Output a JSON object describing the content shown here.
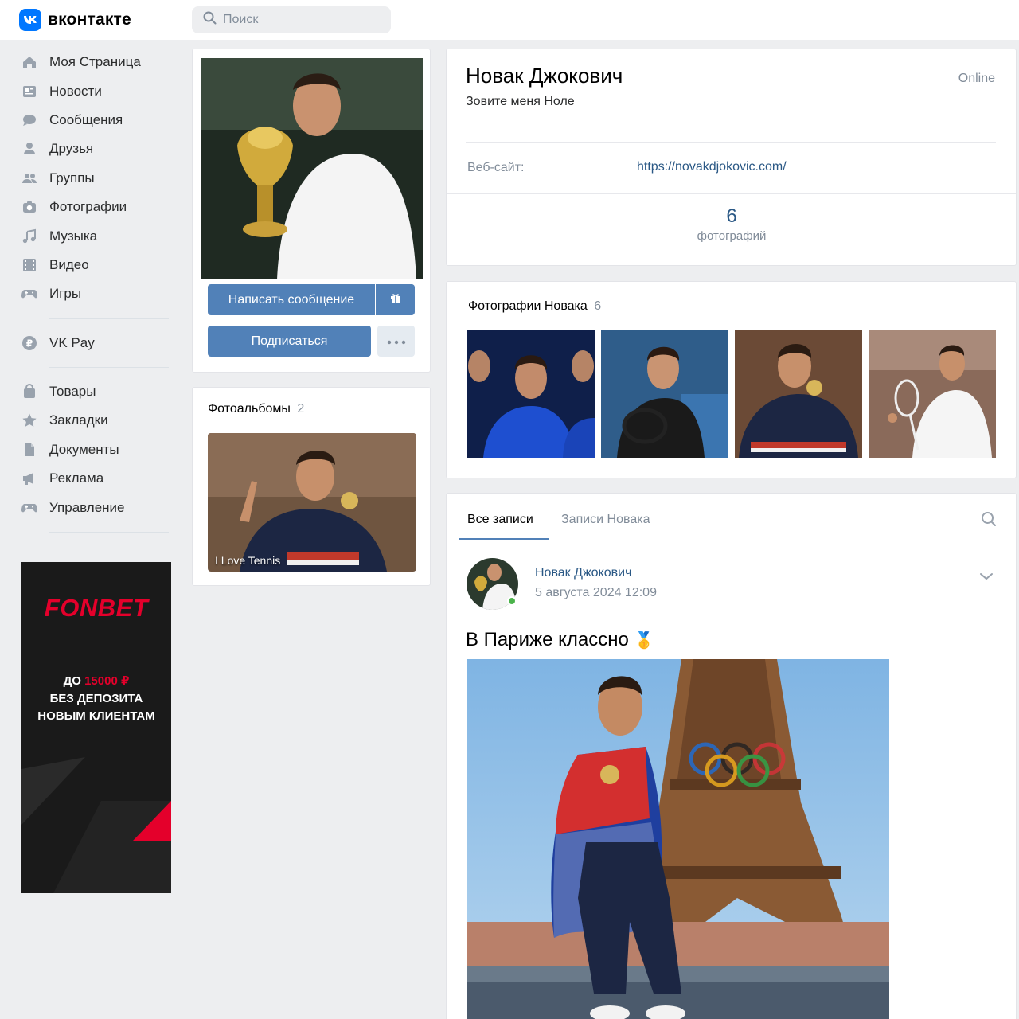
{
  "header": {
    "logo_text": "вконтакте",
    "search_placeholder": "Поиск"
  },
  "sidebar": {
    "items": [
      {
        "label": "Моя Страница",
        "icon": "home-icon"
      },
      {
        "label": "Новости",
        "icon": "news-icon"
      },
      {
        "label": "Сообщения",
        "icon": "messages-icon"
      },
      {
        "label": "Друзья",
        "icon": "friends-icon"
      },
      {
        "label": "Группы",
        "icon": "groups-icon"
      },
      {
        "label": "Фотографии",
        "icon": "camera-icon"
      },
      {
        "label": "Музыка",
        "icon": "music-icon"
      },
      {
        "label": "Видео",
        "icon": "video-icon"
      },
      {
        "label": "Игры",
        "icon": "gamepad-icon"
      },
      {
        "label": "VK Pay",
        "icon": "vkpay-icon"
      },
      {
        "label": "Товары",
        "icon": "bag-icon"
      },
      {
        "label": "Закладки",
        "icon": "star-icon"
      },
      {
        "label": "Документы",
        "icon": "document-icon"
      },
      {
        "label": "Реклама",
        "icon": "megaphone-icon"
      },
      {
        "label": "Управление",
        "icon": "gamepad-icon"
      }
    ]
  },
  "ad": {
    "brand": "FONBET",
    "line1_prefix": "ДО ",
    "line1_amount": "15000 ₽",
    "line2": "БЕЗ ДЕПОЗИТА",
    "line3": "НОВЫМ КЛИЕНТАМ"
  },
  "profile_actions": {
    "message_button": "Написать сообщение",
    "subscribe_button": "Подписаться"
  },
  "albums": {
    "title": "Фотоальбомы",
    "count": "2",
    "album_title": "I Love Tennis"
  },
  "profile": {
    "name": "Новак Джокович",
    "status": "Зовите меня Ноле",
    "online": "Online",
    "website_label": "Веб-сайт:",
    "website_value": "https://novakdjokovic.com/",
    "photos_count": "6",
    "photos_label": "фотографий"
  },
  "photos_block": {
    "title": "Фотографии Новака",
    "count": "6"
  },
  "wall": {
    "tabs": [
      "Все записи",
      "Записи Новака"
    ],
    "post": {
      "author": "Новак Джокович",
      "date": "5 августа 2024 12:09",
      "text": "В Париже классно",
      "emoji": "🥇"
    }
  },
  "colors": {
    "accent": "#5181b8",
    "link": "#2a5885",
    "vk_blue": "#0077ff",
    "fonbet_red": "#e4002b"
  }
}
